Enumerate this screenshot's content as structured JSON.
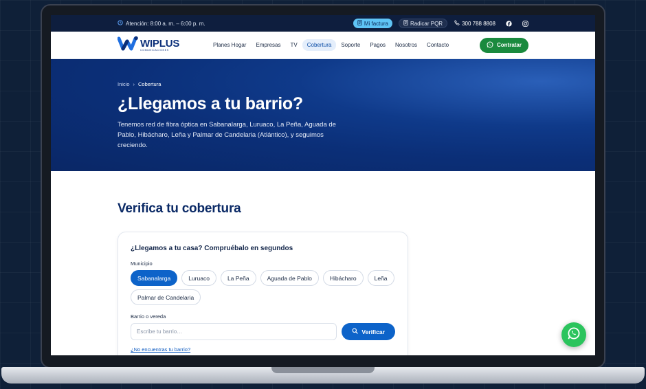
{
  "topbar": {
    "hours": "Atención: 8:00 a. m. – 6:00 p. m.",
    "invoice_label": "Mi factura",
    "pqr_label": "Radicar PQR",
    "phone": "300 788 8808"
  },
  "nav": {
    "brand": "WIPLUS",
    "brand_sub": "COMUNICACIONES",
    "items": [
      "Planes Hogar",
      "Empresas",
      "TV",
      "Cobertura",
      "Soporte",
      "Pagos",
      "Nosotros",
      "Contacto"
    ],
    "active": "Cobertura",
    "cta_label": "Contratar"
  },
  "hero": {
    "breadcrumb_home": "Inicio",
    "breadcrumb_sep": "›",
    "breadcrumb_current": "Cobertura",
    "title": "¿Llegamos a tu barrio?",
    "description": "Tenemos red de fibra óptica en Sabanalarga, Luruaco, La Peña, Aguada de Pablo, Hibácharo, Leña y Palmar de Candelaria (Atlántico), y seguimos creciendo."
  },
  "coverage": {
    "title": "Verifica tu cobertura",
    "card_title": "¿Llegamos a tu casa? Compruébalo en segundos",
    "municipio_label": "Municipio",
    "municipios": [
      "Sabanalarga",
      "Luruaco",
      "La Peña",
      "Aguada de Pablo",
      "Hibácharo",
      "Leña",
      "Palmar de Candelaria"
    ],
    "selected": "Sabanalarga",
    "barrio_label": "Barrio o vereda",
    "barrio_placeholder": "Escribe tu barrio…",
    "verify_label": "Verificar",
    "not_found": "¿No encuentras tu barrio?"
  },
  "colors": {
    "brand_blue": "#0b2f7a",
    "accent_blue": "#0d63c9",
    "whatsapp_green": "#1a8a3e"
  }
}
